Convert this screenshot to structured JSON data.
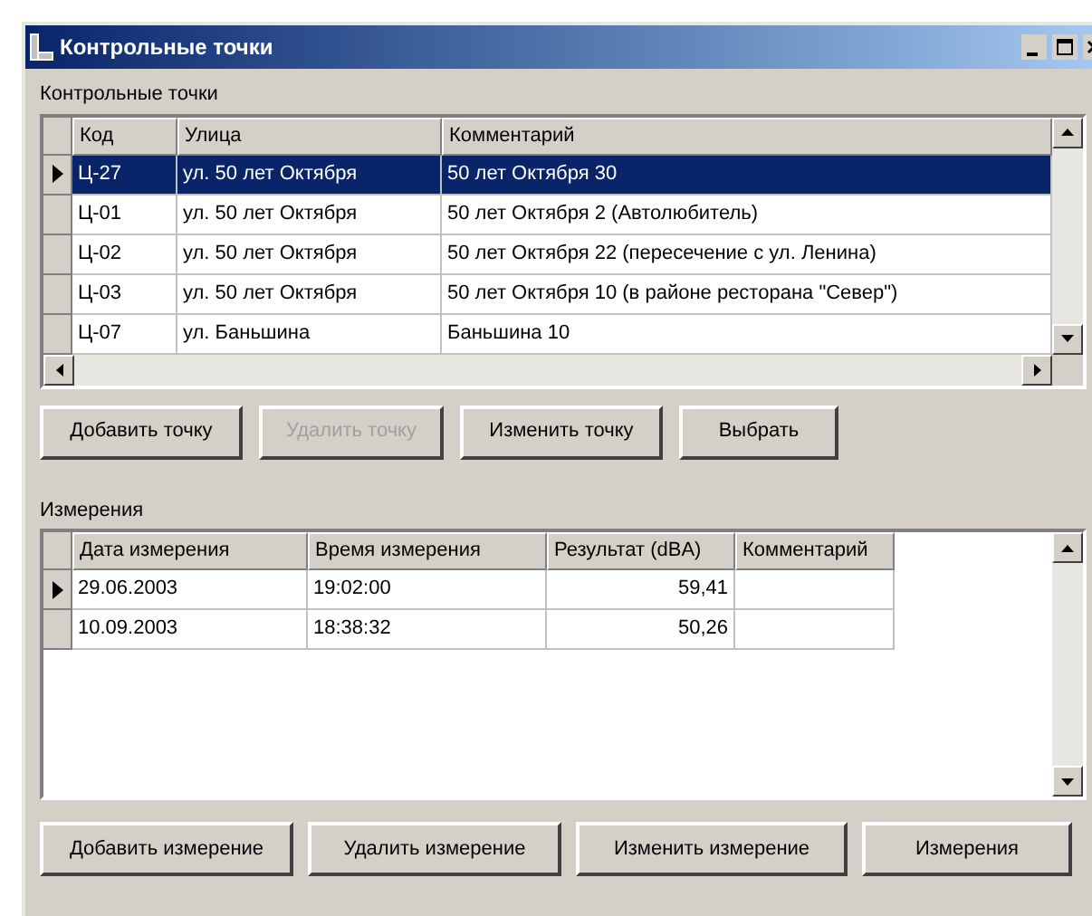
{
  "window": {
    "title": "Контрольные точки"
  },
  "points": {
    "label": "Контрольные точки",
    "columns": [
      "Код",
      "Улица",
      "Комментарий"
    ],
    "rows": [
      {
        "cells": [
          "Ц-27",
          "ул. 50 лет Октября",
          "50 лет Октября 30"
        ],
        "selected": true
      },
      {
        "cells": [
          "Ц-01",
          "ул. 50 лет Октября",
          "50 лет Октября 2 (Автолюбитель)"
        ],
        "selected": false
      },
      {
        "cells": [
          "Ц-02",
          "ул. 50 лет Октября",
          "50 лет Октября 22 (пересечение с ул. Ленина)"
        ],
        "selected": false
      },
      {
        "cells": [
          "Ц-03",
          "ул. 50 лет Октября",
          "50 лет Октября 10 (в районе ресторана \"Север\")"
        ],
        "selected": false
      },
      {
        "cells": [
          "Ц-07",
          "ул. Баньшина",
          "Баньшина 10"
        ],
        "selected": false
      }
    ]
  },
  "point_buttons": [
    {
      "label": "Добавить точку",
      "disabled": false
    },
    {
      "label": "Удалить точку",
      "disabled": true
    },
    {
      "label": "Изменить точку",
      "disabled": false
    },
    {
      "label": "Выбрать",
      "disabled": false
    }
  ],
  "measurements": {
    "label": "Измерения",
    "columns": [
      "Дата измерения",
      "Время измерения",
      "Результат (dBA)",
      "Комментарий"
    ],
    "rows": [
      {
        "cells": [
          "29.06.2003",
          "19:02:00",
          "59,41"
        ],
        "current": true
      },
      {
        "cells": [
          "10.09.2003",
          "18:38:32",
          "50,26"
        ],
        "current": false
      }
    ]
  },
  "measurement_buttons": [
    {
      "label": "Добавить измерение",
      "disabled": false
    },
    {
      "label": "Удалить измерение",
      "disabled": false
    },
    {
      "label": "Изменить измерение",
      "disabled": false
    },
    {
      "label": "Измерения",
      "disabled": false
    }
  ]
}
